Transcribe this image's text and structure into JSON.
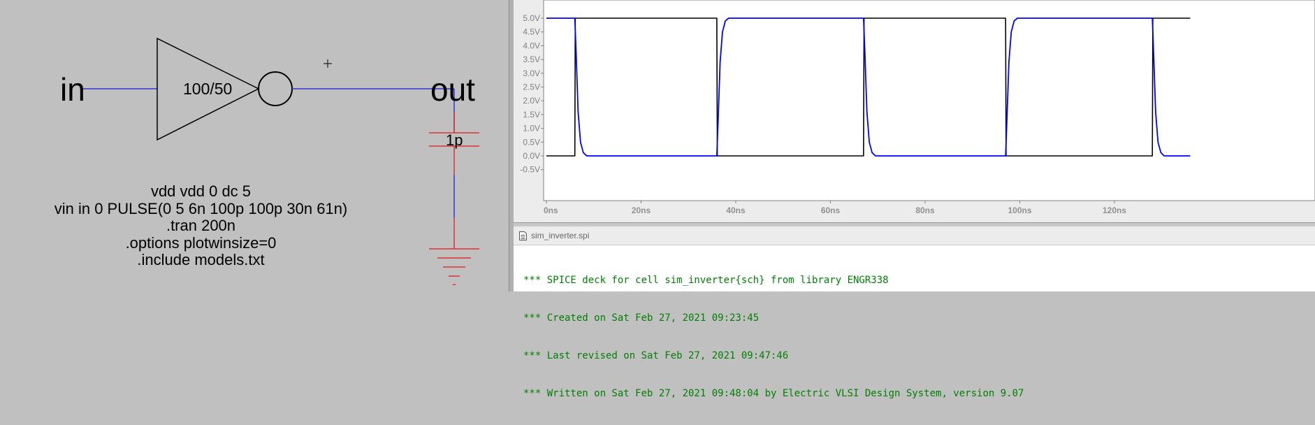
{
  "schematic": {
    "net_in": "in",
    "net_out": "out",
    "gate_size": "100/50",
    "cap_value": "1p",
    "directives": [
      "vdd vdd 0 dc 5",
      "vin in 0 PULSE(0 5 6n 100p 100p 30n 61n)",
      ".tran 200n",
      ".options plotwinsize=0",
      ".include models.txt"
    ],
    "colors": {
      "wire": "#3232d2",
      "component": "#000000",
      "cap_ground": "#dc3232"
    }
  },
  "waveform": {
    "background": "#ffffff",
    "colors": {
      "in": "#000000",
      "out": "#0000ff"
    },
    "chart_data": {
      "type": "line",
      "xlabel": "",
      "ylabel": "",
      "xlim": [
        0,
        136
      ],
      "ylim": [
        -0.5,
        5.0
      ],
      "x_ticks": [
        "0ns",
        "20ns",
        "40ns",
        "60ns",
        "80ns",
        "100ns",
        "120ns"
      ],
      "y_ticks": [
        "5.0V",
        "4.5V",
        "4.0V",
        "3.5V",
        "3.0V",
        "2.5V",
        "2.0V",
        "1.5V",
        "1.0V",
        "0.5V",
        "0.0V",
        "-0.5V"
      ],
      "series": [
        {
          "x": [
            0,
            6,
            6.1,
            36,
            36.1,
            67,
            67.1,
            97,
            97.1,
            128,
            128.1,
            136
          ],
          "y": [
            0,
            0,
            5,
            5,
            0,
            0,
            5,
            5,
            0,
            0,
            5,
            5
          ]
        },
        {
          "x": [
            0,
            6.0,
            6.3,
            6.7,
            7.2,
            7.8,
            8.5,
            36.0,
            36.3,
            36.7,
            37.2,
            37.8,
            38.5,
            67.0,
            67.3,
            67.7,
            68.2,
            68.8,
            69.5,
            97.0,
            97.3,
            97.7,
            98.2,
            98.8,
            99.5,
            128.0,
            128.3,
            128.7,
            129.2,
            129.8,
            130.5,
            136
          ],
          "y": [
            5,
            5,
            3.6,
            1.6,
            0.5,
            0.12,
            0,
            0,
            1.4,
            3.4,
            4.5,
            4.9,
            5,
            5,
            3.6,
            1.6,
            0.5,
            0.12,
            0,
            0,
            1.4,
            3.4,
            4.5,
            4.9,
            5,
            5,
            3.6,
            1.6,
            0.5,
            0.12,
            0,
            0
          ]
        }
      ]
    }
  },
  "editor": {
    "filename": "sim_inverter.spi",
    "lines": [
      "*** SPICE deck for cell sim_inverter{sch} from library ENGR338",
      "*** Created on Sat Feb 27, 2021 09:23:45",
      "*** Last revised on Sat Feb 27, 2021 09:47:46",
      "*** Written on Sat Feb 27, 2021 09:48:04 by Electric VLSI Design System, version 9.07"
    ]
  }
}
